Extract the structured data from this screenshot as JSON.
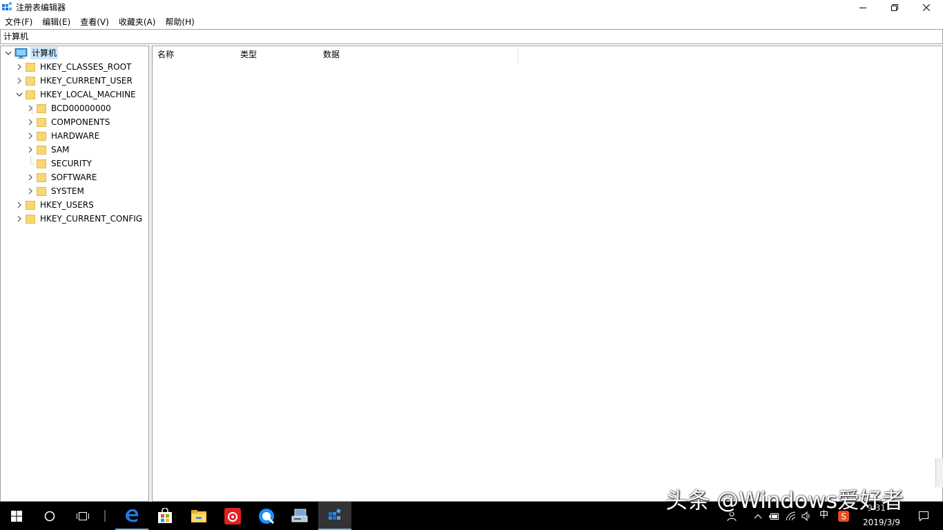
{
  "window": {
    "title": "注册表编辑器"
  },
  "menu": [
    {
      "label": "文件(F)"
    },
    {
      "label": "编辑(E)"
    },
    {
      "label": "查看(V)"
    },
    {
      "label": "收藏夹(A)"
    },
    {
      "label": "帮助(H)"
    }
  ],
  "address": {
    "path": "计算机"
  },
  "tree": {
    "root": "计算机",
    "hives": [
      {
        "label": "HKEY_CLASSES_ROOT",
        "expanded": false
      },
      {
        "label": "HKEY_CURRENT_USER",
        "expanded": false
      },
      {
        "label": "HKEY_LOCAL_MACHINE",
        "expanded": true
      },
      {
        "label": "HKEY_USERS",
        "expanded": false
      },
      {
        "label": "HKEY_CURRENT_CONFIG",
        "expanded": false
      }
    ],
    "hklm_children": [
      {
        "label": "BCD00000000",
        "has_children": true
      },
      {
        "label": "COMPONENTS",
        "has_children": true
      },
      {
        "label": "HARDWARE",
        "has_children": true
      },
      {
        "label": "SAM",
        "has_children": true
      },
      {
        "label": "SECURITY",
        "has_children": false
      },
      {
        "label": "SOFTWARE",
        "has_children": true
      },
      {
        "label": "SYSTEM",
        "has_children": true
      }
    ]
  },
  "list": {
    "columns": [
      "名称",
      "类型",
      "数据"
    ]
  },
  "taskbar": {
    "apps": [
      "start-icon",
      "cortana-icon",
      "task-view-icon",
      "edge-icon",
      "store-icon",
      "file-explorer-icon",
      "netease-music-icon",
      "qq-browser-icon",
      "network-tool-icon",
      "regedit-icon"
    ],
    "ime": "中",
    "time": "9:31",
    "date": "2019/3/9"
  },
  "watermark": {
    "text": "头条 @Windows爱好者"
  },
  "colors": {
    "selection": "#cce8ff",
    "folder": "#f8d775",
    "taskbar": "#000000",
    "accent": "#76b9ed"
  }
}
